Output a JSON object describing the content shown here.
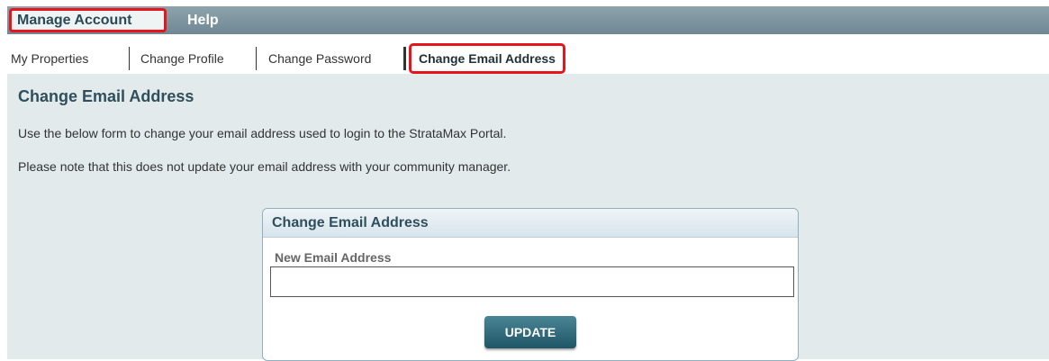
{
  "topnav": {
    "manage_account": "Manage Account",
    "help": "Help"
  },
  "subnav": {
    "my_properties": "My Properties",
    "change_profile": "Change Profile",
    "change_password": "Change Password",
    "change_email": "Change Email Address"
  },
  "page": {
    "title": "Change Email Address",
    "desc1": "Use the below form to change your email address used to login to the StrataMax Portal.",
    "desc2": "Please note that this does not update your email address with your community manager."
  },
  "form": {
    "panel_title": "Change Email Address",
    "new_email_label": "New Email Address",
    "new_email_value": "",
    "update_label": "UPDATE"
  },
  "colors": {
    "highlight": "#e8141c",
    "accent": "#2f4f5c",
    "button": "#1f5566"
  }
}
